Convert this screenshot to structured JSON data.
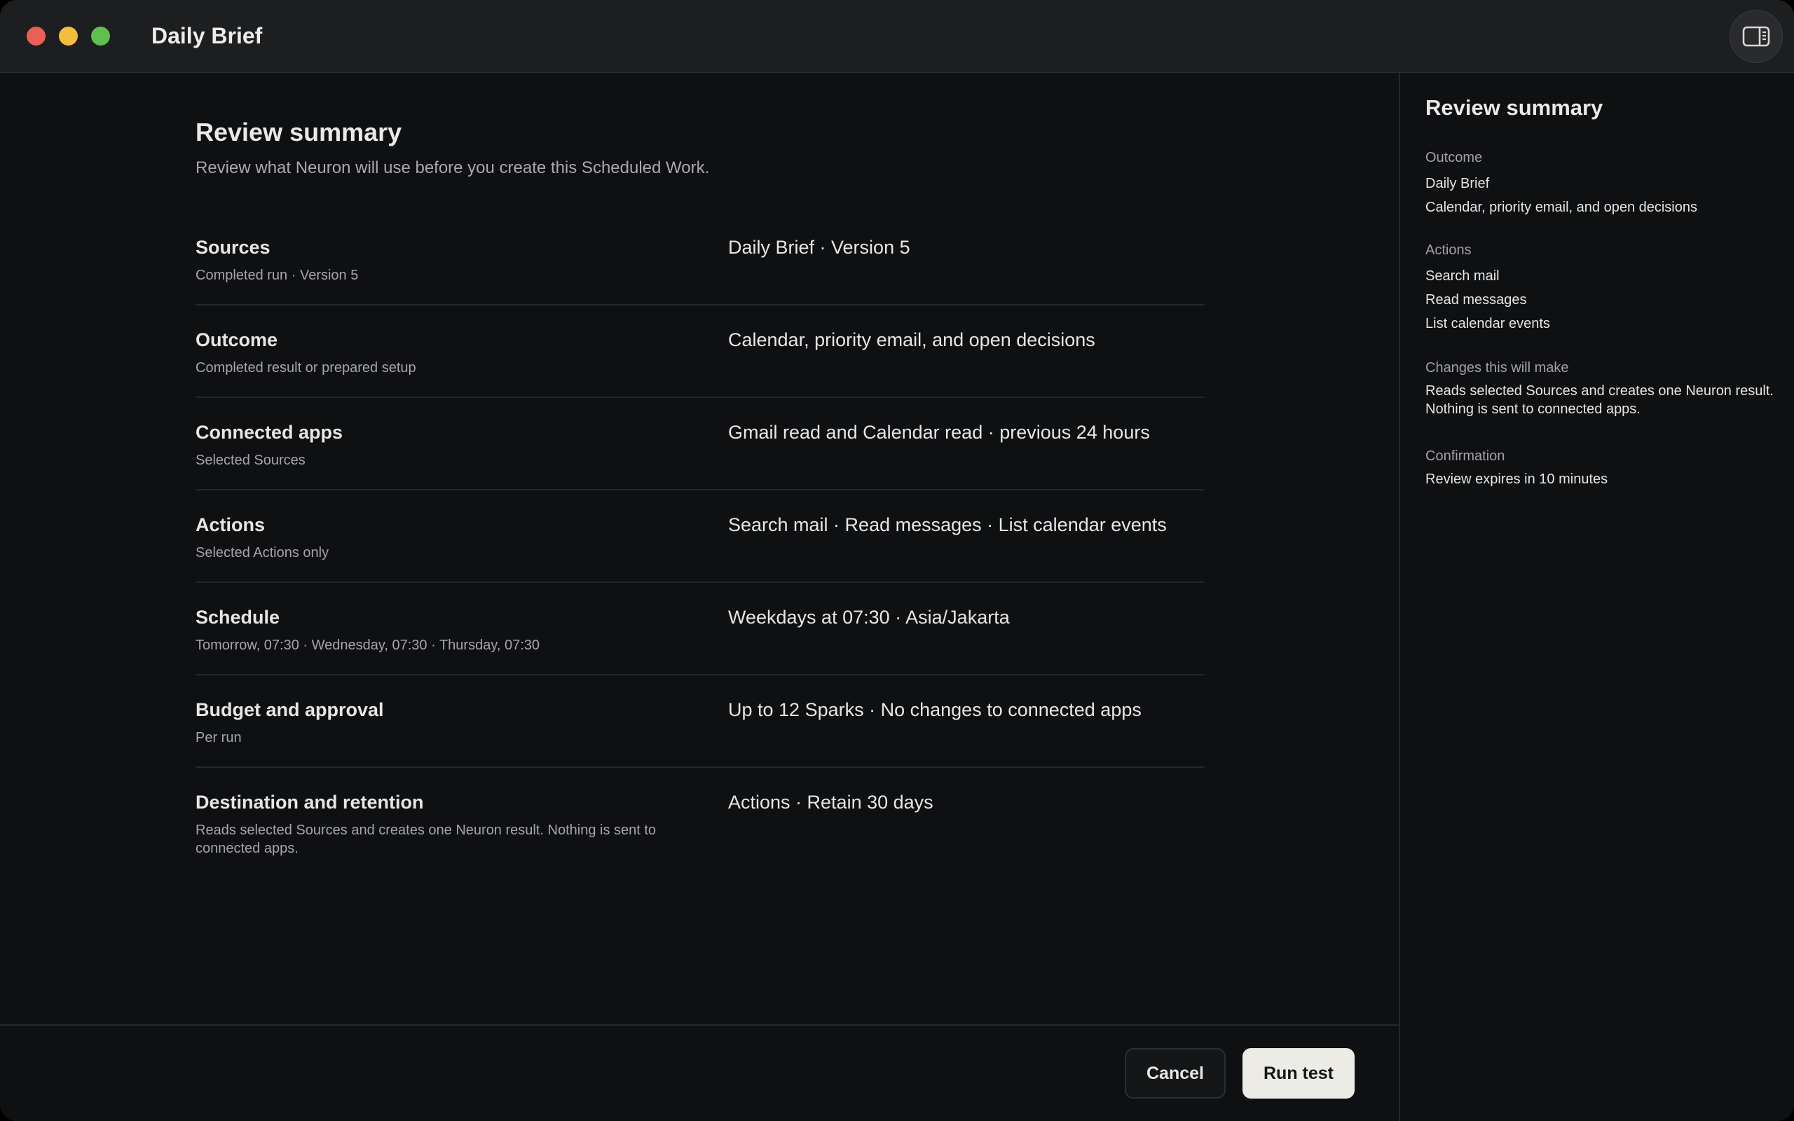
{
  "window": {
    "title": "Daily Brief"
  },
  "main": {
    "title": "Review summary",
    "subtitle": "Review what Neuron will use before you create this Scheduled Work.",
    "rows": [
      {
        "label": "Sources",
        "sub": "Completed run · Version 5",
        "value": "Daily Brief · Version 5"
      },
      {
        "label": "Outcome",
        "sub": "Completed result or prepared setup",
        "value": "Calendar, priority email, and open decisions"
      },
      {
        "label": "Connected apps",
        "sub": "Selected Sources",
        "value": "Gmail read and Calendar read · previous 24 hours"
      },
      {
        "label": "Actions",
        "sub": "Selected Actions only",
        "value": "Search mail · Read messages · List calendar events"
      },
      {
        "label": "Schedule",
        "sub": "Tomorrow, 07:30 · Wednesday, 07:30 · Thursday, 07:30",
        "value": "Weekdays at 07:30 · Asia/Jakarta"
      },
      {
        "label": "Budget and approval",
        "sub": "Per run",
        "value": "Up to 12 Sparks · No changes to connected apps"
      },
      {
        "label": "Destination and retention",
        "sub": "Reads selected Sources and creates one Neuron result. Nothing is sent to connected apps.",
        "value": "Actions · Retain 30 days"
      }
    ]
  },
  "footer": {
    "cancel_label": "Cancel",
    "run_label": "Run test"
  },
  "panel": {
    "title": "Review summary",
    "outcome": {
      "label": "Outcome",
      "lines": [
        "Daily Brief",
        "Calendar, priority email, and open decisions"
      ]
    },
    "actions": {
      "label": "Actions",
      "lines": [
        "Search mail",
        "Read messages",
        "List calendar events"
      ]
    },
    "changes": {
      "label": "Changes this will make",
      "text": "Reads selected Sources and creates one Neuron result. Nothing is sent to connected apps."
    },
    "confirmation": {
      "label": "Confirmation",
      "text": "Review expires in 10 minutes"
    }
  },
  "colors": {
    "accent_button": "#ecebe6",
    "background": "#0f1012",
    "titlebar": "#1d1e20"
  },
  "icons": {
    "sidebar_toggle": "sidebar-toggle-icon"
  }
}
